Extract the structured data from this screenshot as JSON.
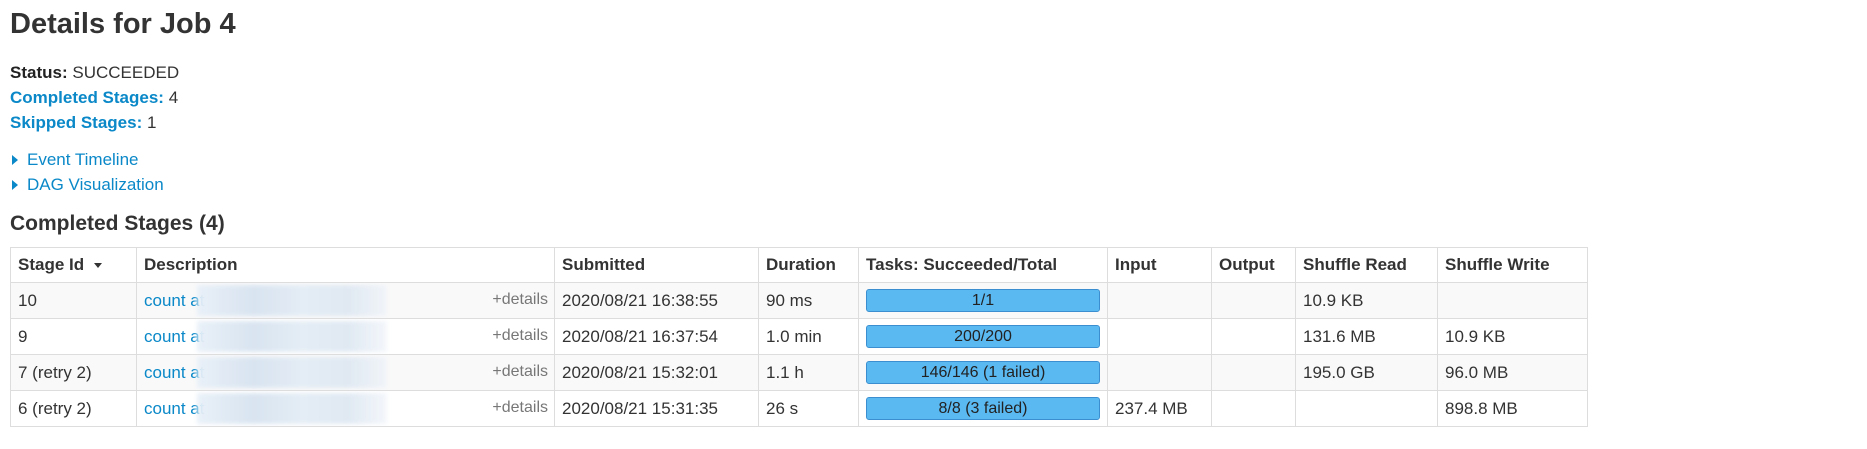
{
  "page": {
    "title": "Details for Job 4"
  },
  "summary": {
    "status_label": "Status:",
    "status_value": "SUCCEEDED",
    "completed_label": "Completed Stages:",
    "completed_value": "4",
    "skipped_label": "Skipped Stages:",
    "skipped_value": "1"
  },
  "toggles": {
    "event_timeline": "Event Timeline",
    "dag_visualization": "DAG Visualization"
  },
  "section": {
    "completed_stages_title": "Completed Stages (4)"
  },
  "table": {
    "headers": {
      "stage_id": "Stage Id",
      "description": "Description",
      "submitted": "Submitted",
      "duration": "Duration",
      "tasks": "Tasks: Succeeded/Total",
      "input": "Input",
      "output": "Output",
      "shuffle_read": "Shuffle Read",
      "shuffle_write": "Shuffle Write"
    },
    "rows": [
      {
        "stage_id": "10",
        "description": "count at",
        "details": "+details",
        "submitted": "2020/08/21 16:38:55",
        "duration": "90 ms",
        "tasks": "1/1",
        "tasks_succeeded": 1,
        "tasks_total": 1,
        "input": "",
        "output": "",
        "shuffle_read": "10.9 KB",
        "shuffle_write": ""
      },
      {
        "stage_id": "9",
        "description": "count at",
        "details": "+details",
        "submitted": "2020/08/21 16:37:54",
        "duration": "1.0 min",
        "tasks": "200/200",
        "tasks_succeeded": 200,
        "tasks_total": 200,
        "input": "",
        "output": "",
        "shuffle_read": "131.6 MB",
        "shuffle_write": "10.9 KB"
      },
      {
        "stage_id": "7 (retry 2)",
        "description": "count at",
        "details": "+details",
        "submitted": "2020/08/21 15:32:01",
        "duration": "1.1 h",
        "tasks": "146/146 (1 failed)",
        "tasks_succeeded": 146,
        "tasks_total": 146,
        "input": "",
        "output": "",
        "shuffle_read": "195.0 GB",
        "shuffle_write": "96.0 MB"
      },
      {
        "stage_id": "6 (retry 2)",
        "description": "count at",
        "details": "+details",
        "submitted": "2020/08/21 15:31:35",
        "duration": "26 s",
        "tasks": "8/8 (3 failed)",
        "tasks_succeeded": 8,
        "tasks_total": 8,
        "input": "237.4 MB",
        "output": "",
        "shuffle_read": "",
        "shuffle_write": "898.8 MB"
      }
    ]
  },
  "colors": {
    "link": "#0a88c8",
    "progress_fill": "#5ab9f1",
    "progress_border": "#3b8fd0",
    "details_link": "#777777"
  },
  "icons": {
    "toggle": "caret-right-icon",
    "sort": "sort-desc-icon"
  }
}
